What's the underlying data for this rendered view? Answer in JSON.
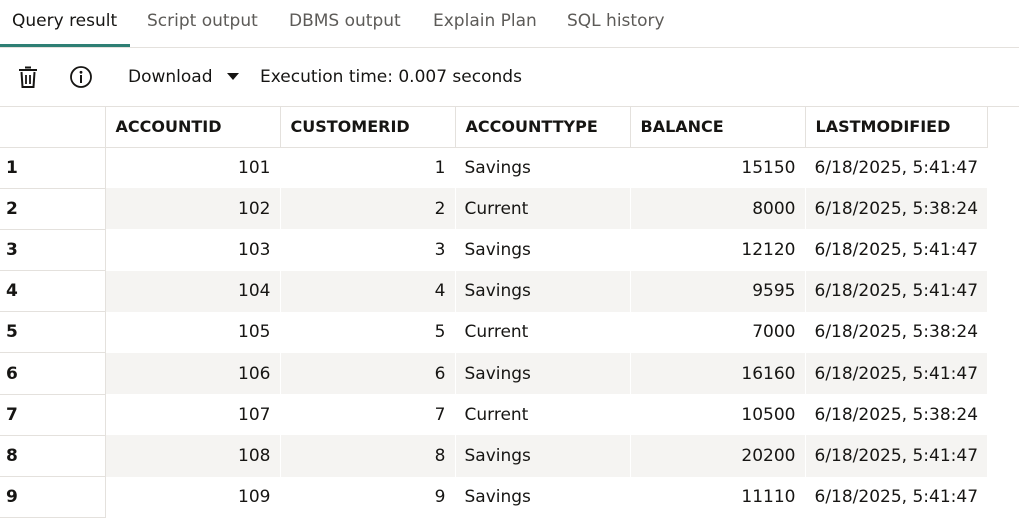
{
  "tabs": [
    {
      "label": "Query result"
    },
    {
      "label": "Script output"
    },
    {
      "label": "DBMS output"
    },
    {
      "label": "Explain Plan"
    },
    {
      "label": "SQL history"
    }
  ],
  "toolbar": {
    "delete_icon": "trash-icon",
    "info_icon": "info-icon",
    "download_label": "Download",
    "execution_time": "Execution time: 0.007 seconds"
  },
  "grid": {
    "columns": [
      "ACCOUNTID",
      "CUSTOMERID",
      "ACCOUNTTYPE",
      "BALANCE",
      "LASTMODIFIED"
    ],
    "rows": [
      {
        "n": "1",
        "accountid": "101",
        "customerid": "1",
        "accounttype": "Savings",
        "balance": "15150",
        "lastmodified": "6/18/2025, 5:41:47"
      },
      {
        "n": "2",
        "accountid": "102",
        "customerid": "2",
        "accounttype": "Current",
        "balance": "8000",
        "lastmodified": "6/18/2025, 5:38:24"
      },
      {
        "n": "3",
        "accountid": "103",
        "customerid": "3",
        "accounttype": "Savings",
        "balance": "12120",
        "lastmodified": "6/18/2025, 5:41:47"
      },
      {
        "n": "4",
        "accountid": "104",
        "customerid": "4",
        "accounttype": "Savings",
        "balance": "9595",
        "lastmodified": "6/18/2025, 5:41:47"
      },
      {
        "n": "5",
        "accountid": "105",
        "customerid": "5",
        "accounttype": "Current",
        "balance": "7000",
        "lastmodified": "6/18/2025, 5:38:24"
      },
      {
        "n": "6",
        "accountid": "106",
        "customerid": "6",
        "accounttype": "Savings",
        "balance": "16160",
        "lastmodified": "6/18/2025, 5:41:47"
      },
      {
        "n": "7",
        "accountid": "107",
        "customerid": "7",
        "accounttype": "Current",
        "balance": "10500",
        "lastmodified": "6/18/2025, 5:38:24"
      },
      {
        "n": "8",
        "accountid": "108",
        "customerid": "8",
        "accounttype": "Savings",
        "balance": "20200",
        "lastmodified": "6/18/2025, 5:41:47"
      },
      {
        "n": "9",
        "accountid": "109",
        "customerid": "9",
        "accounttype": "Savings",
        "balance": "11110",
        "lastmodified": "6/18/2025, 5:41:47"
      }
    ]
  },
  "colors": {
    "accent": "#2e7f74",
    "row_alt": "#f5f4f2",
    "border": "#e4e1dd"
  }
}
